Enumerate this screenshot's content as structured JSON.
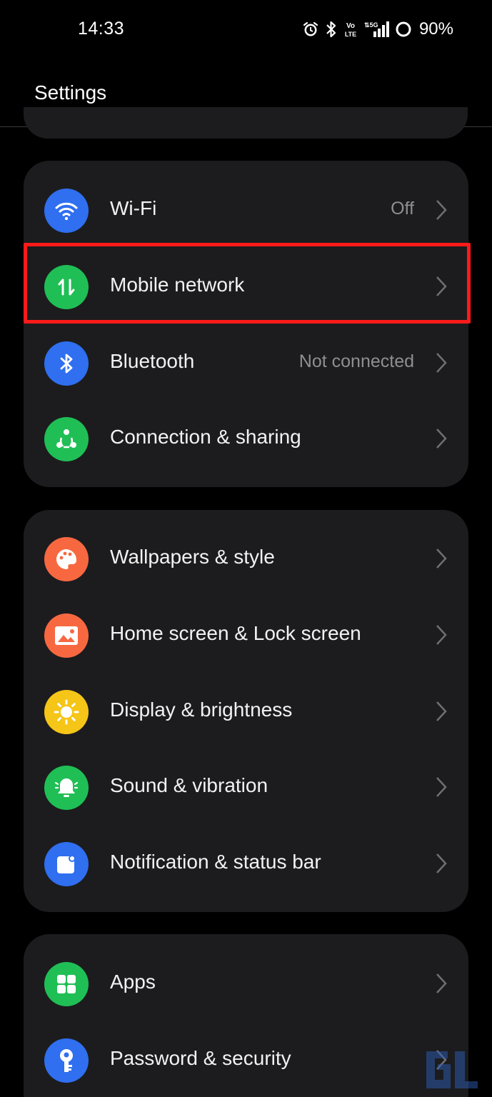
{
  "status_bar": {
    "time": "14:33",
    "battery_text": "90%",
    "icons": [
      "alarm-icon",
      "bluetooth-icon",
      "volte-icon",
      "5g-signal-icon",
      "battery-icon"
    ],
    "network_label": "5G",
    "volte_label": "Vo LTE"
  },
  "header": {
    "title": "Settings"
  },
  "colors": {
    "background": "#000000",
    "card": "#1c1c1e",
    "blue": "#2f6ff0",
    "green": "#1fbf55",
    "orange": "#f76841",
    "yellow": "#f5c518",
    "highlight": "#ff1a1a",
    "secondary_text": "#8e8e93"
  },
  "groups": [
    {
      "items": [
        {
          "label": "Wi-Fi",
          "value": "Off",
          "icon": "wifi-icon",
          "color": "#2f6ff0"
        },
        {
          "label": "Mobile network",
          "value": "",
          "icon": "mobile-data-icon",
          "color": "#1fbf55",
          "highlighted": true
        },
        {
          "label": "Bluetooth",
          "value": "Not connected",
          "icon": "bluetooth-icon",
          "color": "#2f6ff0"
        },
        {
          "label": "Connection & sharing",
          "value": "",
          "icon": "share-icon",
          "color": "#1fbf55"
        }
      ]
    },
    {
      "items": [
        {
          "label": "Wallpapers & style",
          "value": "",
          "icon": "palette-icon",
          "color": "#f76841"
        },
        {
          "label": "Home screen & Lock screen",
          "value": "",
          "icon": "image-icon",
          "color": "#f76841"
        },
        {
          "label": "Display & brightness",
          "value": "",
          "icon": "sun-icon",
          "color": "#f5c518"
        },
        {
          "label": "Sound & vibration",
          "value": "",
          "icon": "bell-icon",
          "color": "#1fbf55"
        },
        {
          "label": "Notification & status bar",
          "value": "",
          "icon": "notification-icon",
          "color": "#2f6ff0"
        }
      ]
    },
    {
      "items": [
        {
          "label": "Apps",
          "value": "",
          "icon": "apps-grid-icon",
          "color": "#1fbf55"
        },
        {
          "label": "Password & security",
          "value": "",
          "icon": "key-icon",
          "color": "#2f6ff0"
        }
      ]
    }
  ]
}
